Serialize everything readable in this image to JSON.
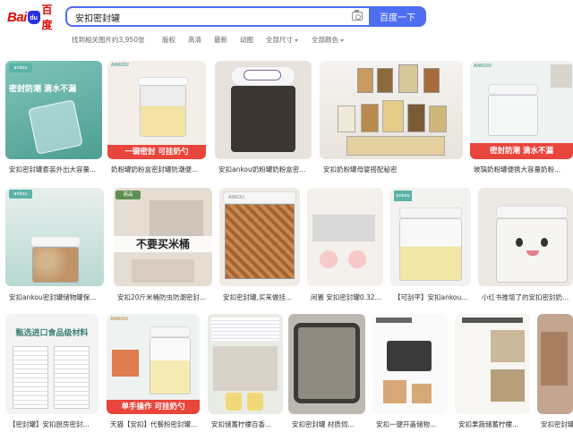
{
  "header": {
    "logo_left": "Bai",
    "logo_paw": "du",
    "logo_right": "百度",
    "search_value": "安扣密封罐",
    "search_button": "百度一下"
  },
  "filters": {
    "result_count": "找到相关图片约3,950张",
    "copyright": "版权",
    "hd": "高清",
    "latest": "最新",
    "animated": "动图",
    "all_sizes": "全部尺寸",
    "all_colors": "全部颜色"
  },
  "colors": {
    "brand_blue": "#4e6ef2",
    "brand_red": "#e10602",
    "teal_banner": "#3fa89e",
    "red_banner": "#e8453c"
  },
  "rows": [
    {
      "tiles": [
        {
          "caption": "安扣密封罐套装外出大容量...",
          "banner": "密封防潮 滴水不漏",
          "brand": "ankou"
        },
        {
          "caption": "奶粉罐奶粉盒密封罐防潮便...",
          "banner": "一键密封 可挂奶勺",
          "brand": "ANKOU"
        },
        {
          "caption": "安扣ankou奶粉罐奶粉盒密...",
          "banner": "",
          "brand": ""
        },
        {
          "caption": "安扣奶粉罐母婴搭配秘密",
          "banner": "",
          "brand": ""
        },
        {
          "caption": "玻璃奶粉罐便携大容量奶粉...",
          "banner": "密封防潮 滴水不漏",
          "brand": "ANKOU"
        }
      ]
    },
    {
      "tiles": [
        {
          "caption": "安扣ankou密封罐储物罐保...",
          "banner": "",
          "brand": "ankou"
        },
        {
          "caption": "安扣20斤米桶防虫防潮密封...",
          "banner": "不要买米桶",
          "brand": "商品"
        },
        {
          "caption": "安扣密封罐,买来做挂...",
          "banner": "",
          "brand": "ANKOU"
        },
        {
          "caption": "闲置 安扣密封罐0.32...",
          "banner": "",
          "brand": ""
        },
        {
          "caption": "【可刮平】安扣ankou...",
          "banner": "",
          "brand": "ankou"
        },
        {
          "caption": "小红书推增了的安扣密封奶...",
          "banner": "",
          "brand": ""
        }
      ]
    },
    {
      "tiles": [
        {
          "caption": "【密封罐】安扣厨房密封...",
          "banner": "甄选进口食品级材料",
          "brand": ""
        },
        {
          "caption": "天猫【安扣】代餐粉密封罐...",
          "banner": "单手操作 可挂奶勺",
          "brand": "ANKOU"
        },
        {
          "caption": "安扣储蓄柠檬百香...",
          "banner": "",
          "brand": ""
        },
        {
          "caption": "安扣密封罐 材质伺...",
          "banner": "",
          "brand": ""
        },
        {
          "caption": "安扣一键开盖储物...",
          "banner": "",
          "brand": ""
        },
        {
          "caption": "安扣果蔬储蓄柠檬...",
          "banner": "",
          "brand": ""
        },
        {
          "caption": "安扣密封罐 ...",
          "banner": "",
          "brand": ""
        }
      ]
    }
  ]
}
